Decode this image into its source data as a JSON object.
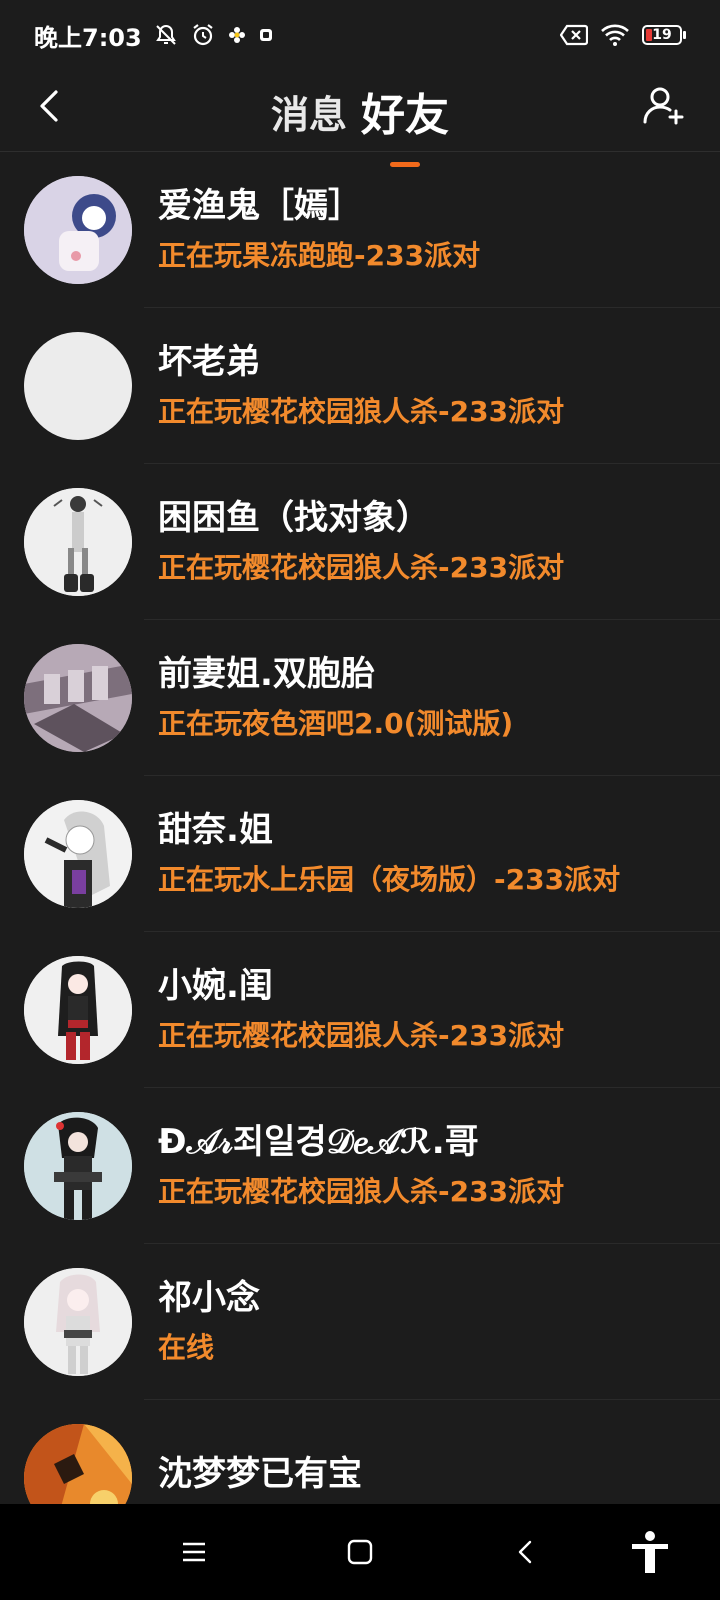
{
  "status_bar": {
    "time": "晚上7:03",
    "battery_level": "19",
    "battery_fraction": 0.19,
    "icons": [
      "mute-bell-icon",
      "alarm-icon",
      "flower-icon",
      "app-notification-icon",
      "sim-missing-icon",
      "wifi-icon",
      "battery-icon"
    ]
  },
  "header": {
    "back_icon": "chevron-left-icon",
    "tabs": [
      {
        "label": "消息",
        "selected": false
      },
      {
        "label": "好友",
        "selected": true
      }
    ],
    "add_friend_icon": "add-user-icon",
    "accent_color": "#f26a1b"
  },
  "friends": [
    {
      "name": "爱渔鬼［嫣］",
      "status": "正在玩果冻跑跑-233派对",
      "avatar_bg": "#d9d3e6"
    },
    {
      "name": "坏老弟",
      "status": "正在玩樱花校园狼人杀-233派对",
      "avatar_bg": "#ececec"
    },
    {
      "name": "困困鱼（找对象）",
      "status": "正在玩樱花校园狼人杀-233派对",
      "avatar_bg": "#efefef"
    },
    {
      "name": "前妻姐.双胞胎",
      "status": "正在玩夜色酒吧2.0(测试版)",
      "avatar_bg": "#a89aa8"
    },
    {
      "name": "甜奈.姐",
      "status": "正在玩水上乐园（夜场版）-233派对",
      "avatar_bg": "#f2f2f2"
    },
    {
      "name": "小婉.闺",
      "status": "正在玩樱花校园狼人杀-233派对",
      "avatar_bg": "#f0f0f0"
    },
    {
      "name": "Ɖ𝒜𝓇죄일경𝒟𝑒𝒜ℛ.哥",
      "status": "正在玩樱花校园狼人杀-233派对",
      "avatar_bg": "#cfe0e4"
    },
    {
      "name": "祁小念",
      "status": "在线",
      "avatar_bg": "#efefef"
    },
    {
      "name": "沈梦梦已有宝",
      "status": "",
      "avatar_bg": "#e8892c"
    }
  ],
  "nav_bar": {
    "icons": [
      "menu-icon",
      "home-icon",
      "back-icon",
      "accessibility-icon"
    ]
  },
  "colors": {
    "background": "#1c1c1c",
    "status_text": "#f28a2c",
    "accent": "#f26a1b"
  }
}
